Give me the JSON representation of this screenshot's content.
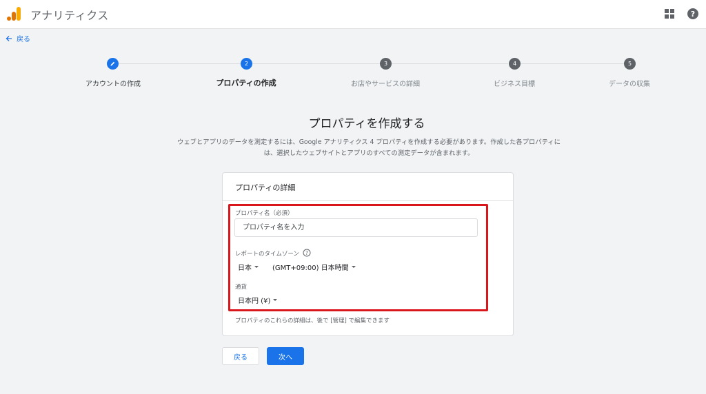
{
  "app": {
    "title": "アナリティクス",
    "brand_colors": [
      "#f9ab00",
      "#e37400"
    ]
  },
  "header": {
    "apps_icon": "apps-grid-icon",
    "help_icon": "help-circle-icon"
  },
  "nav": {
    "back_label": "戻る"
  },
  "stepper": {
    "steps": [
      {
        "number": "",
        "label": "アカウントの作成",
        "state": "done"
      },
      {
        "number": "2",
        "label": "プロパティの作成",
        "state": "current"
      },
      {
        "number": "3",
        "label": "お店やサービスの詳細",
        "state": "future"
      },
      {
        "number": "4",
        "label": "ビジネス目標",
        "state": "future"
      },
      {
        "number": "5",
        "label": "データの収集",
        "state": "future"
      }
    ]
  },
  "main": {
    "title": "プロパティを作成する",
    "description": "ウェブとアプリのデータを測定するには、Google アナリティクス 4 プロパティを作成する必要があります。作成した各プロパティには、選択したウェブサイトとアプリのすべての測定データが含まれます。"
  },
  "card": {
    "title": "プロパティの詳細",
    "property_name_label": "プロパティ名（必須）",
    "property_name_placeholder": "プロパティ名を入力",
    "timezone_label": "レポートのタイムゾーン",
    "country_value": "日本",
    "timezone_value": "(GMT+09:00) 日本時間",
    "currency_label": "通貨",
    "currency_value": "日本円 (¥)",
    "note": "プロパティのこれらの詳細は、後で [管理] で編集できます"
  },
  "actions": {
    "back_label": "戻る",
    "next_label": "次へ"
  },
  "colors": {
    "accent": "#1a73e8",
    "highlight": "#d9161c"
  }
}
